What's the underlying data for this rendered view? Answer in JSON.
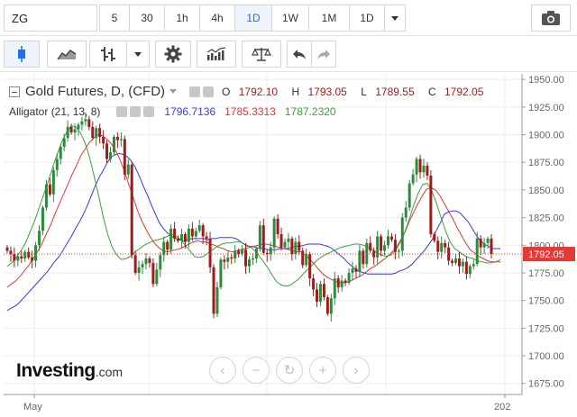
{
  "toolbar": {
    "symbol": "ZG",
    "intervals": [
      "5",
      "30",
      "1h",
      "4h",
      "1D",
      "1W",
      "1M",
      "1D"
    ],
    "active_interval": "1D"
  },
  "legend": {
    "title": "Gold Futures, D, (CFD)",
    "o_label": "O",
    "o_value": "1792.10",
    "h_label": "H",
    "h_value": "1793.05",
    "l_label": "L",
    "l_value": "1789.55",
    "c_label": "C",
    "c_value": "1792.05",
    "indicator": "Alligator (21, 13, 8)",
    "jaw": "1796.7136",
    "teeth": "1785.3313",
    "lips": "1787.2320"
  },
  "logo": {
    "main": "Investing",
    "suffix": ".com"
  },
  "icons": [
    "camera-icon",
    "candles-icon",
    "line-chart-icon",
    "bars-icon",
    "gear-icon",
    "indicators-icon",
    "scale-icon",
    "undo-icon",
    "redo-icon",
    "zoom-out-icon",
    "zoom-in-icon",
    "reset-icon",
    "scroll-left-icon",
    "scroll-right-icon"
  ],
  "colors": {
    "up": "#2e8b3e",
    "down": "#9e1c1c",
    "jaw": "#3a3ad6",
    "teeth": "#d23b3b",
    "lips": "#3aa13a",
    "price_line": "#e53935",
    "price_label_bg": "#e53935",
    "accent": "#1a73e8"
  },
  "chart_data": {
    "type": "candlestick",
    "title": "Gold Futures, D, (CFD)",
    "ylim": [
      1665,
      1955
    ],
    "y_ticks": [
      "1950.00",
      "1925.00",
      "1900.00",
      "1875.00",
      "1850.00",
      "1825.00",
      "1800.00",
      "1775.00",
      "1750.00",
      "1725.00",
      "1700.00",
      "1675.00"
    ],
    "x_ticks": [
      "May",
      "202"
    ],
    "current_price": "1792.05",
    "series": [
      {
        "name": "Close",
        "values": [
          1795,
          1792,
          1786,
          1790,
          1788,
          1794,
          1789,
          1786,
          1800,
          1813,
          1834,
          1855,
          1846,
          1868,
          1878,
          1889,
          1897,
          1907,
          1902,
          1905,
          1909,
          1912,
          1914,
          1907,
          1897,
          1906,
          1898,
          1892,
          1878,
          1884,
          1898,
          1895,
          1896,
          1864,
          1873,
          1791,
          1775,
          1780,
          1783,
          1788,
          1784,
          1765,
          1778,
          1791,
          1803,
          1796,
          1815,
          1806,
          1804,
          1810,
          1803,
          1815,
          1808,
          1813,
          1818,
          1808,
          1806,
          1780,
          1738,
          1762,
          1787,
          1785,
          1789,
          1788,
          1795,
          1792,
          1796,
          1781,
          1787,
          1788,
          1797,
          1818,
          1793,
          1792,
          1798,
          1824,
          1810,
          1798,
          1803,
          1806,
          1792,
          1803,
          1795,
          1782,
          1792,
          1770,
          1760,
          1749,
          1765,
          1753,
          1738,
          1752,
          1770,
          1762,
          1768,
          1766,
          1775,
          1779,
          1776,
          1795,
          1783,
          1802,
          1795,
          1789,
          1808,
          1795,
          1800,
          1808,
          1805,
          1794,
          1795,
          1825,
          1834,
          1856,
          1864,
          1878,
          1866,
          1872,
          1863,
          1810,
          1804,
          1794,
          1802,
          1798,
          1786,
          1784,
          1788,
          1781,
          1785,
          1774,
          1781,
          1783,
          1806,
          1798,
          1802,
          1806,
          1792
        ]
      },
      {
        "name": "Alligator jaw (21)",
        "values": [
          1741,
          1743,
          1745,
          1748,
          1752,
          1756,
          1760,
          1764,
          1768,
          1772,
          1776,
          1781,
          1786,
          1790,
          1796,
          1802,
          1808,
          1815,
          1821,
          1828,
          1836,
          1845,
          1854,
          1862,
          1868,
          1875,
          1880,
          1882,
          1883,
          1882,
          1880,
          1876,
          1870,
          1862,
          1853,
          1845,
          1836,
          1828,
          1820,
          1815,
          1811,
          1808,
          1806,
          1805,
          1804,
          1805,
          1806,
          1806,
          1806,
          1806,
          1805,
          1806,
          1806,
          1807,
          1807,
          1807,
          1807,
          1806,
          1804,
          1801,
          1799,
          1799,
          1798,
          1797,
          1797,
          1796,
          1796,
          1796,
          1797,
          1797,
          1797,
          1798,
          1799,
          1799,
          1800,
          1801,
          1801,
          1801,
          1801,
          1800,
          1799,
          1797,
          1794,
          1791,
          1788,
          1784,
          1781,
          1778,
          1776,
          1775,
          1774,
          1774,
          1774,
          1774,
          1774,
          1774,
          1774,
          1775,
          1777,
          1778,
          1780,
          1783,
          1787,
          1791,
          1795,
          1800,
          1805,
          1813,
          1820,
          1828,
          1830,
          1831,
          1831,
          1829,
          1825,
          1821,
          1815,
          1809,
          1804,
          1801,
          1799,
          1797,
          1797,
          1797
        ]
      },
      {
        "name": "Alligator teeth (13)",
        "values": [
          1762,
          1765,
          1768,
          1772,
          1777,
          1782,
          1788,
          1794,
          1801,
          1810,
          1818,
          1828,
          1837,
          1846,
          1855,
          1864,
          1872,
          1881,
          1887,
          1893,
          1897,
          1900,
          1899,
          1896,
          1892,
          1886,
          1878,
          1868,
          1856,
          1845,
          1833,
          1823,
          1815,
          1808,
          1802,
          1798,
          1795,
          1794,
          1795,
          1796,
          1797,
          1799,
          1801,
          1803,
          1804,
          1803,
          1803,
          1801,
          1800,
          1798,
          1797,
          1795,
          1794,
          1795,
          1796,
          1797,
          1798,
          1799,
          1800,
          1801,
          1801,
          1800,
          1799,
          1798,
          1797,
          1796,
          1795,
          1794,
          1794,
          1791,
          1787,
          1783,
          1778,
          1774,
          1771,
          1769,
          1767,
          1766,
          1766,
          1767,
          1769,
          1771,
          1773,
          1776,
          1779,
          1781,
          1784,
          1787,
          1790,
          1794,
          1798,
          1805,
          1812,
          1822,
          1830,
          1838,
          1845,
          1851,
          1852,
          1850,
          1845,
          1838,
          1831,
          1824,
          1816,
          1809,
          1802,
          1796,
          1793,
          1790,
          1788,
          1786,
          1785,
          1785,
          1785
        ]
      },
      {
        "name": "Alligator lips (8)",
        "values": [
          1781,
          1784,
          1789,
          1795,
          1802,
          1812,
          1822,
          1834,
          1846,
          1858,
          1871,
          1883,
          1894,
          1902,
          1908,
          1907,
          1902,
          1893,
          1880,
          1863,
          1845,
          1826,
          1810,
          1798,
          1791,
          1787,
          1788,
          1790,
          1794,
          1797,
          1800,
          1802,
          1804,
          1805,
          1806,
          1808,
          1810,
          1808,
          1805,
          1800,
          1795,
          1790,
          1789,
          1790,
          1793,
          1796,
          1799,
          1801,
          1802,
          1802,
          1803,
          1803,
          1801,
          1799,
          1796,
          1791,
          1786,
          1780,
          1773,
          1767,
          1764,
          1763,
          1764,
          1767,
          1770,
          1775,
          1779,
          1783,
          1787,
          1790,
          1792,
          1794,
          1796,
          1798,
          1799,
          1800,
          1801,
          1801,
          1800,
          1798,
          1796,
          1793,
          1791,
          1790,
          1791,
          1795,
          1802,
          1811,
          1823,
          1836,
          1847,
          1855,
          1856,
          1849,
          1838,
          1825,
          1813,
          1803,
          1797,
          1794,
          1791,
          1789,
          1788,
          1786,
          1785,
          1784,
          1784,
          1785,
          1787
        ]
      }
    ]
  }
}
